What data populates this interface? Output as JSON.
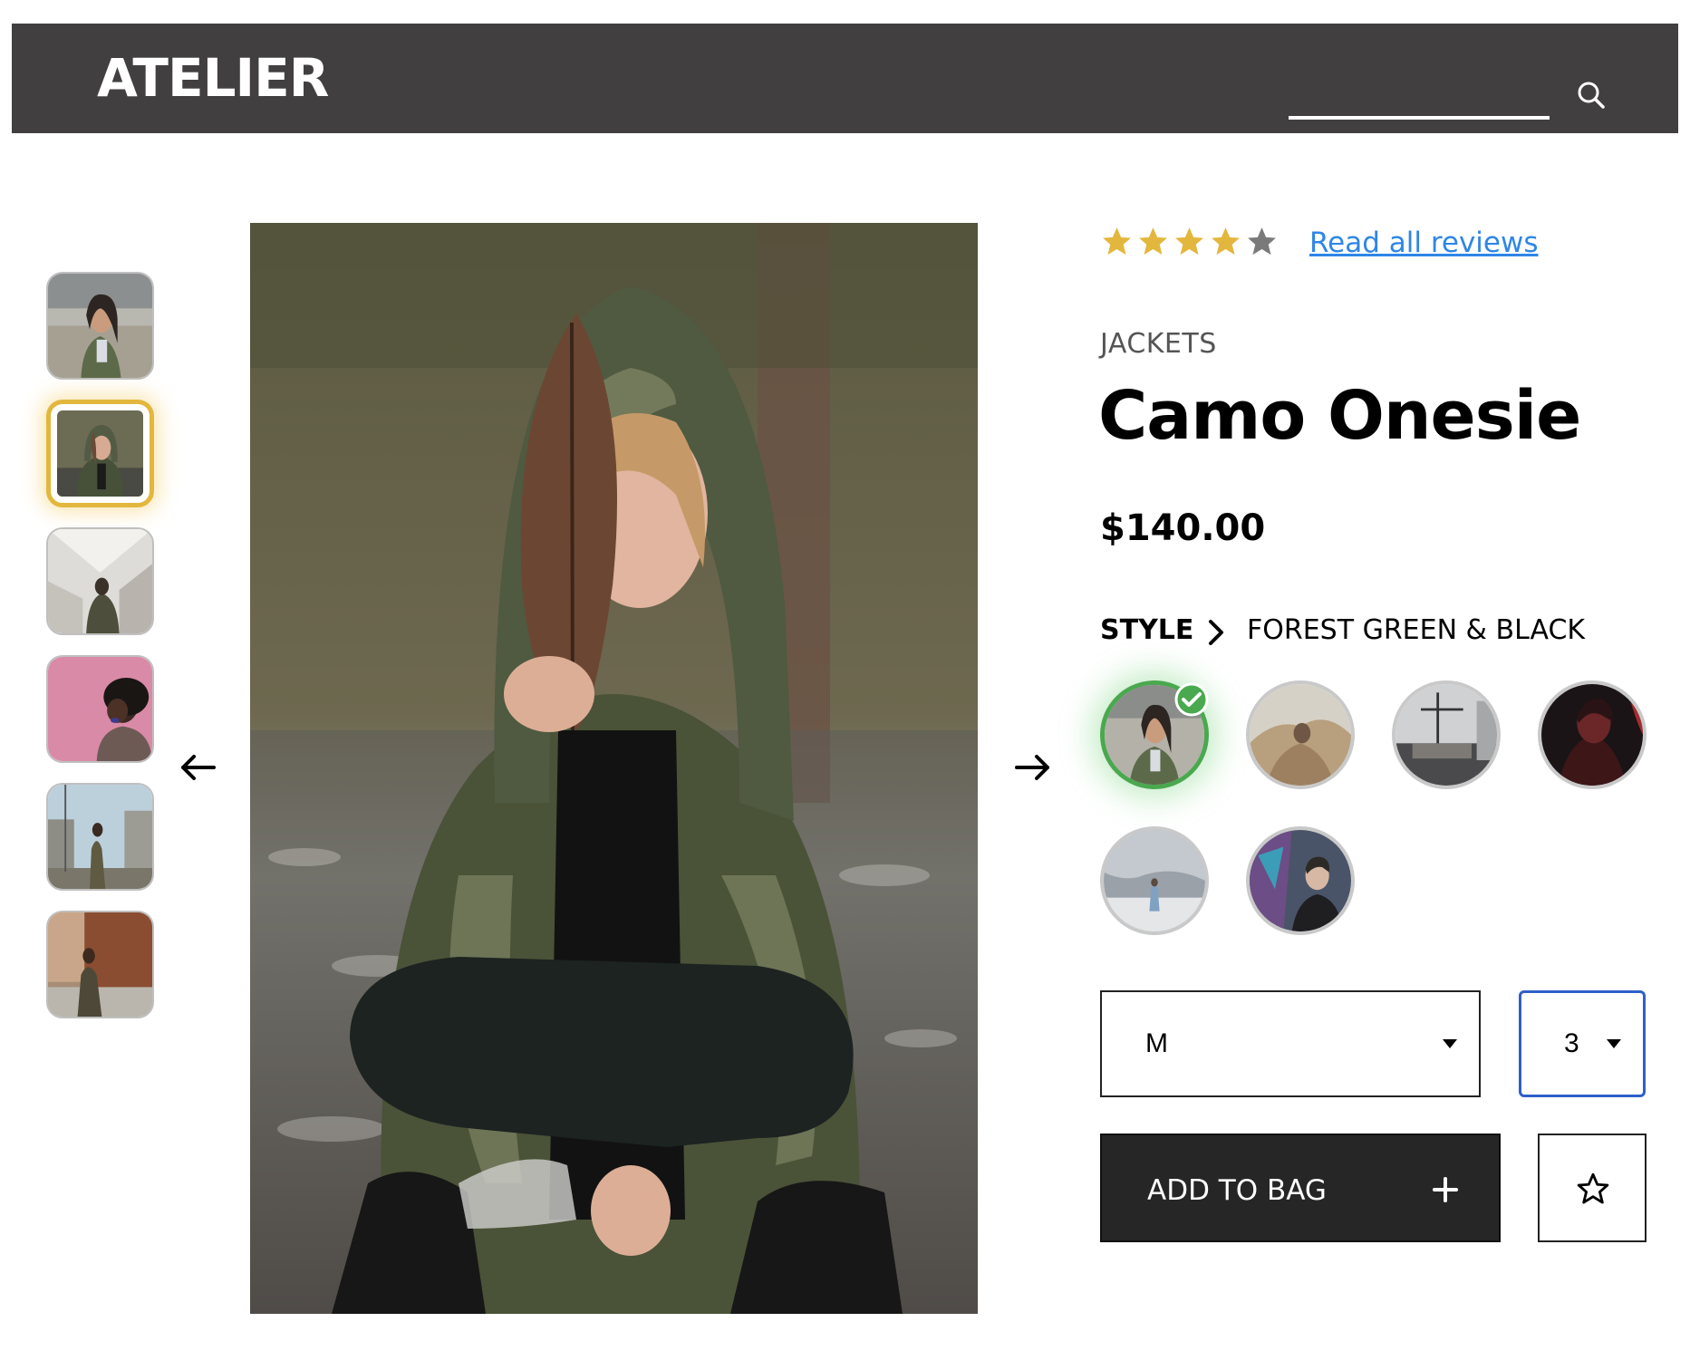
{
  "header": {
    "logo": "ATELIER",
    "search_value": "",
    "background": "#413f40",
    "icon": "search-icon"
  },
  "gallery": {
    "thumbnails": [
      {
        "icon": "thumbnail-photo",
        "active": false
      },
      {
        "icon": "thumbnail-photo",
        "active": true
      },
      {
        "icon": "thumbnail-photo",
        "active": false
      },
      {
        "icon": "thumbnail-photo",
        "active": false
      },
      {
        "icon": "thumbnail-photo",
        "active": false
      },
      {
        "icon": "thumbnail-photo",
        "active": false
      }
    ],
    "active_border_color": "#e3b73d",
    "prev_icon": "arrow-left-icon",
    "next_icon": "arrow-right-icon"
  },
  "product": {
    "rating": 4,
    "rating_max": 5,
    "star_color": "#e3b73d",
    "reviews_link": "Read all reviews",
    "category": "JACKETS",
    "name": "Camo Onesie",
    "price": "$140.00",
    "style_label": "STYLE",
    "style_value": "FOREST GREEN & BLACK",
    "selected_swatch": 0,
    "swatch_count": 6,
    "selected_color": "#4aa84f",
    "size": {
      "value": "M"
    },
    "quantity": {
      "value": "3"
    },
    "add_to_bag": "ADD TO BAG",
    "link_color": "#2f86e6"
  }
}
